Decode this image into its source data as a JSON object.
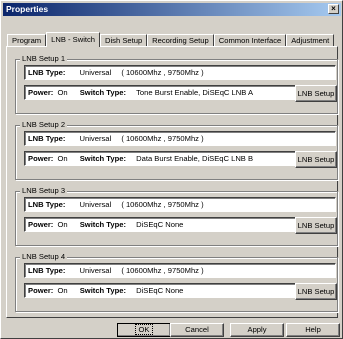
{
  "window": {
    "title": "Properties",
    "close_glyph": "×"
  },
  "tabs": [
    {
      "label": "Program",
      "active": false
    },
    {
      "label": "LNB - Switch",
      "active": true
    },
    {
      "label": "Dish Setup",
      "active": false
    },
    {
      "label": "Recording Setup",
      "active": false
    },
    {
      "label": "Common Interface",
      "active": false
    },
    {
      "label": "Adjustment",
      "active": false
    }
  ],
  "groups": [
    {
      "label": "LNB Setup 1",
      "lnb_type_label": "LNB Type:",
      "lnb_type": "Universal",
      "lnb_freq": "( 10600Mhz ,   9750Mhz )",
      "power_label": "Power:",
      "power": "On",
      "switch_label": "Switch Type:",
      "switch": "Tone Burst Enable, DiSEqC LNB A",
      "button": "LNB Setup"
    },
    {
      "label": "LNB Setup 2",
      "lnb_type_label": "LNB Type:",
      "lnb_type": "Universal",
      "lnb_freq": "( 10600Mhz ,   9750Mhz )",
      "power_label": "Power:",
      "power": "On",
      "switch_label": "Switch Type:",
      "switch": "Data Burst Enable, DiSEqC LNB B",
      "button": "LNB Setup"
    },
    {
      "label": "LNB Setup 3",
      "lnb_type_label": "LNB Type:",
      "lnb_type": "Universal",
      "lnb_freq": "( 10600Mhz ,   9750Mhz )",
      "power_label": "Power:",
      "power": "On",
      "switch_label": "Switch Type:",
      "switch": "DiSEqC None",
      "button": "LNB Setup"
    },
    {
      "label": "LNB Setup 4",
      "lnb_type_label": "LNB Type:",
      "lnb_type": "Universal",
      "lnb_freq": "( 10600Mhz ,   9750Mhz )",
      "power_label": "Power:",
      "power": "On",
      "switch_label": "Switch Type:",
      "switch": "DiSEqC None",
      "button": "LNB Setup"
    }
  ],
  "buttons": {
    "ok": "OK",
    "cancel": "Cancel",
    "apply": "Apply",
    "help": "Help"
  }
}
